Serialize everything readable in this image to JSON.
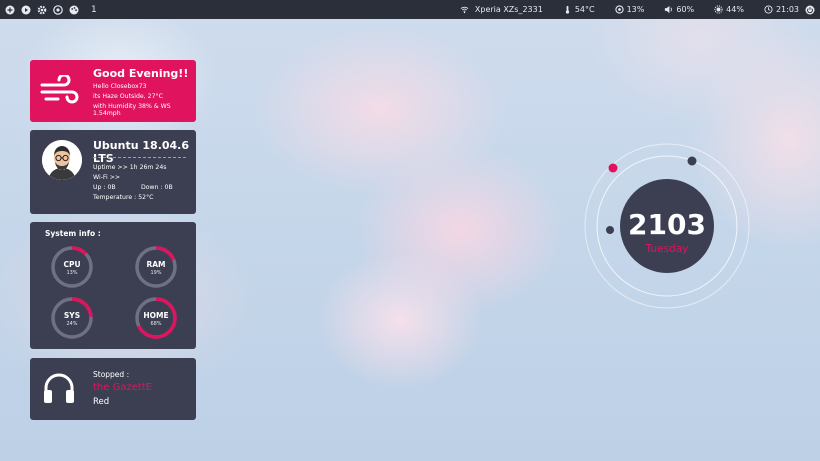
{
  "topbar": {
    "workspace": "1",
    "device": "Xperia XZs_2331",
    "cpu_temp": "54°C",
    "cpu_usage": "13%",
    "volume": "60%",
    "brightness": "44%",
    "clock": "21:03"
  },
  "greeting": {
    "title": "Good Evening!!",
    "line1": "Hello Closebox73",
    "line2": "its Haze Outside, 27°C",
    "line3": "with Humidity 38% & WS 1.54mph"
  },
  "system": {
    "os": "Ubuntu 18.04.6 LTS",
    "uptime": "Uptime >> 1h 26m 24s",
    "wifi": "Wi-Fi >>",
    "up": "Up : 0B",
    "down": "Down : 0B",
    "temperature": "Temperature : 52°C"
  },
  "sysinfo": {
    "header": "System info :",
    "gauges": [
      {
        "label": "CPU",
        "value": "13%",
        "fraction": 0.13
      },
      {
        "label": "RAM",
        "value": "19%",
        "fraction": 0.19
      },
      {
        "label": "SYS",
        "value": "24%",
        "fraction": 0.24
      },
      {
        "label": "HOME",
        "value": "68%",
        "fraction": 0.68
      }
    ]
  },
  "music": {
    "status": "Stopped :",
    "title": "the GazettE",
    "artist": "Red"
  },
  "clock_widget": {
    "time": "2103",
    "day": "Tuesday"
  },
  "colors": {
    "accent": "#e0135f",
    "panel": "#3c3f52",
    "topbar": "#2b2f3a"
  }
}
